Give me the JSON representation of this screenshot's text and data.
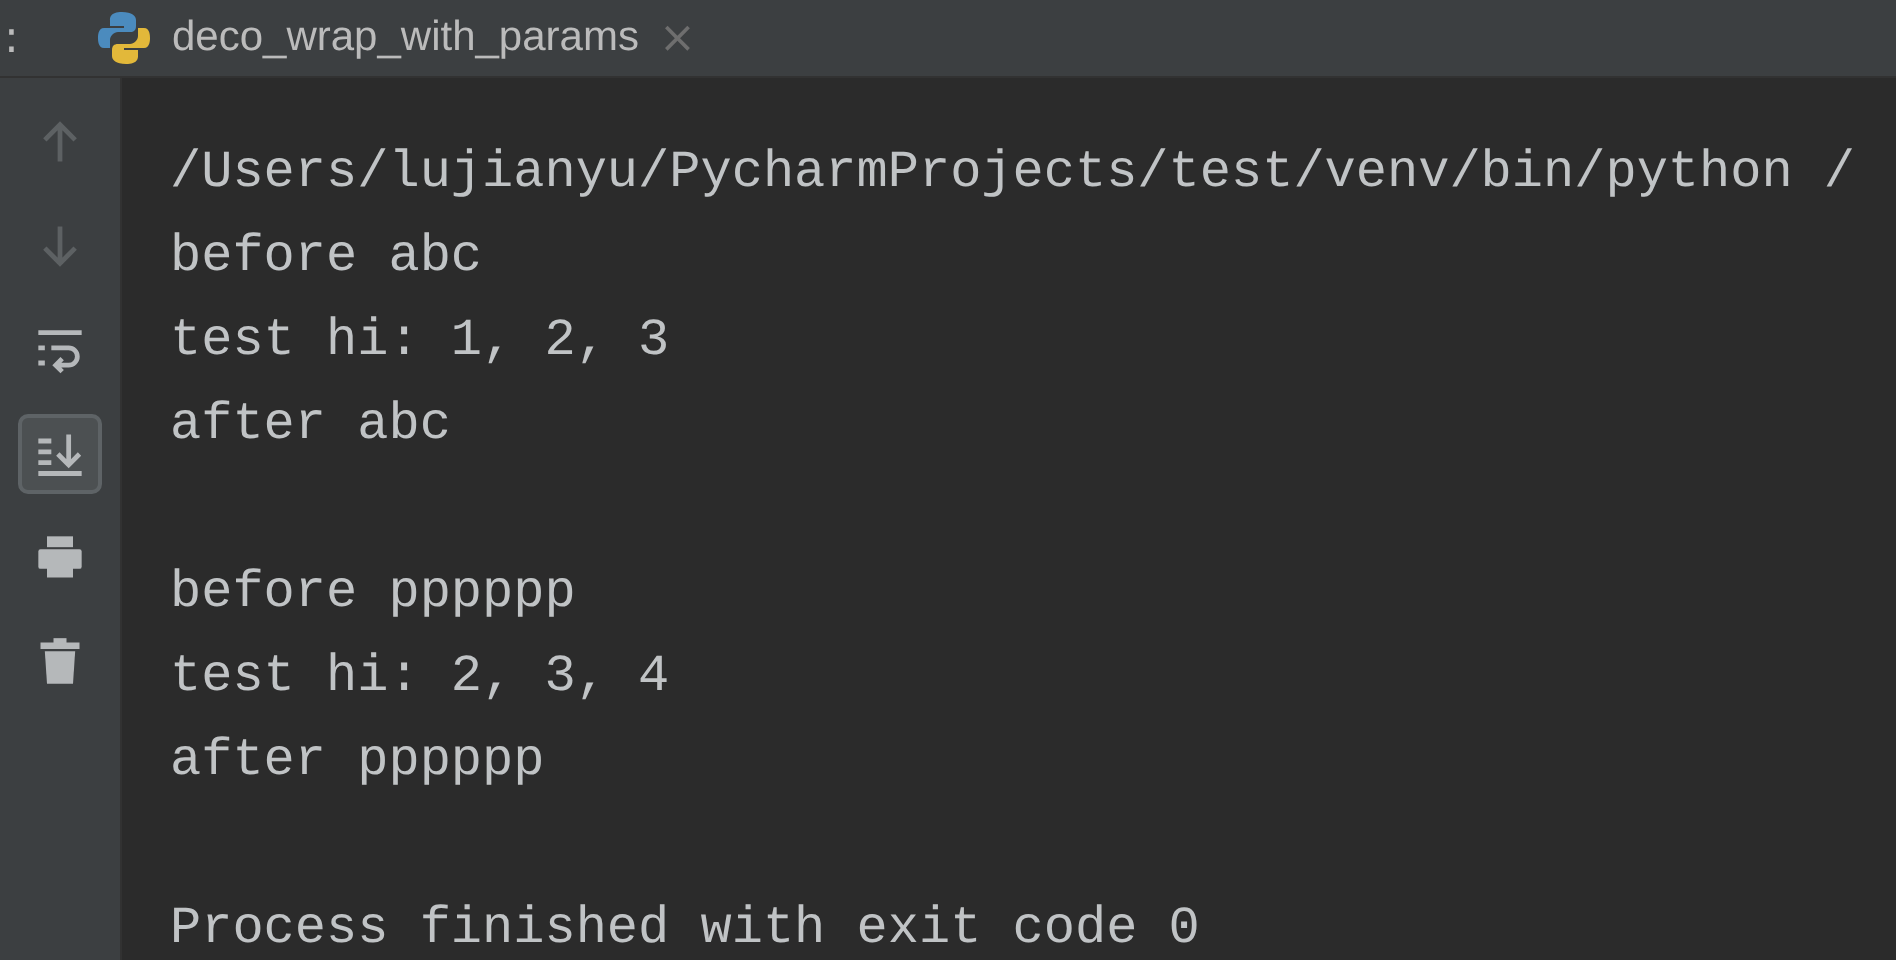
{
  "panel_label": ":",
  "tab": {
    "title": "deco_wrap_with_params",
    "close": "×"
  },
  "toolbar": [
    {
      "kind": "up",
      "disabled": true,
      "selected": false
    },
    {
      "kind": "down",
      "disabled": true,
      "selected": false
    },
    {
      "kind": "wrap",
      "disabled": false,
      "selected": false
    },
    {
      "kind": "scroll",
      "disabled": false,
      "selected": true
    },
    {
      "kind": "print",
      "disabled": false,
      "selected": false
    },
    {
      "kind": "trash",
      "disabled": false,
      "selected": false
    }
  ],
  "console_blocks": [
    {
      "lines": [
        "/Users/lujianyu/PycharmProjects/test/venv/bin/python /",
        "before abc",
        "test hi: 1, 2, 3",
        "after abc"
      ]
    },
    {
      "lines": [
        "before pppppp",
        "test hi: 2, 3, 4",
        "after pppppp"
      ]
    },
    {
      "lines": [
        "Process finished with exit code 0"
      ]
    }
  ]
}
